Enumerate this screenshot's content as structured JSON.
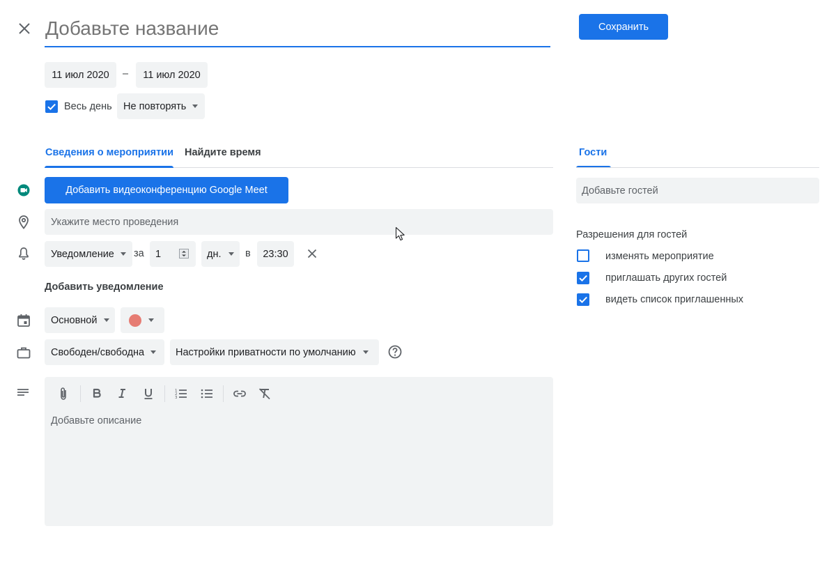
{
  "header": {
    "title_placeholder": "Добавьте название",
    "save_label": "Сохранить"
  },
  "dates": {
    "start": "11 июл 2020",
    "separator": "–",
    "end": "11 июл 2020"
  },
  "all_day": {
    "label": "Весь день",
    "checked": true
  },
  "repeat": {
    "value": "Не повторять"
  },
  "tabs": {
    "details": "Сведения о мероприятии",
    "find_time": "Найдите время",
    "guests": "Гости"
  },
  "meet_button": "Добавить видеоконференцию Google Meet",
  "location": {
    "placeholder": "Укажите место проведения"
  },
  "notification": {
    "type": "Уведомление",
    "prefix": "за",
    "amount": "1",
    "unit": "дн.",
    "at": "в",
    "time": "23:30",
    "add_label": "Добавить уведомление"
  },
  "calendar": {
    "name": "Основной",
    "color": "#e67c73"
  },
  "availability": {
    "status": "Свободен/свободна",
    "privacy": "Настройки приватности по умолчанию"
  },
  "description": {
    "placeholder": "Добавьте описание"
  },
  "guests": {
    "input_placeholder": "Добавьте гостей",
    "permissions_title": "Разрешения для гостей",
    "permissions": [
      {
        "label": "изменять мероприятие",
        "checked": false
      },
      {
        "label": "приглашать других гостей",
        "checked": true
      },
      {
        "label": "видеть список приглашенных",
        "checked": true
      }
    ]
  },
  "colors": {
    "accent": "#1a73e8",
    "meet_green": "#00897b",
    "chip_bg": "#f1f3f4"
  }
}
